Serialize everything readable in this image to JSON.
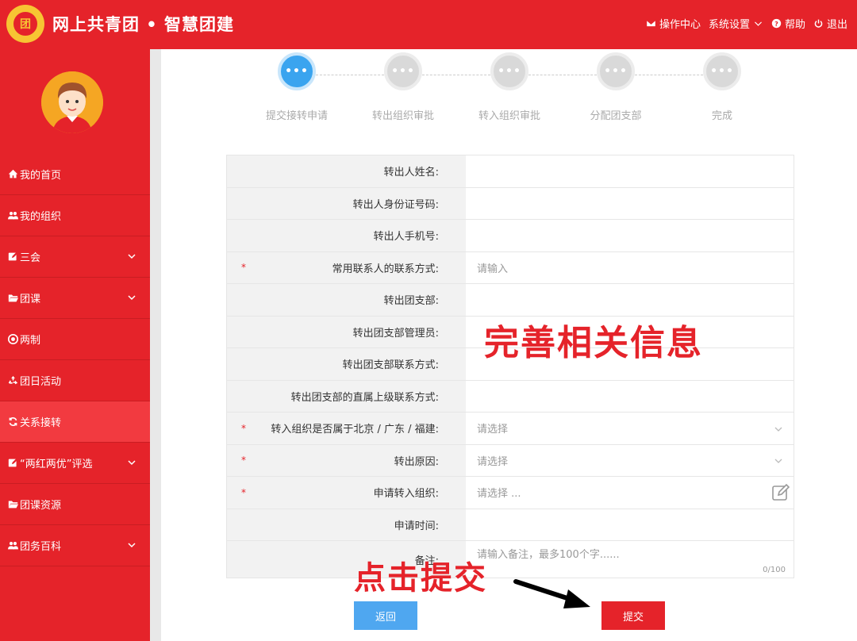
{
  "header": {
    "title": "网上共青团 • 智慧团建",
    "nav": [
      {
        "label": "操作中心",
        "icon": "envelope-icon"
      },
      {
        "label": "系统设置",
        "icon": "chevron-down-icon"
      },
      {
        "label": "帮助",
        "icon": "help-icon"
      },
      {
        "label": "退出",
        "icon": "power-icon"
      }
    ]
  },
  "sidebar": {
    "items": [
      {
        "label": "我的首页",
        "icon": "home-icon",
        "expandable": false
      },
      {
        "label": "我的组织",
        "icon": "users-icon",
        "expandable": false
      },
      {
        "label": "三会",
        "icon": "edit-icon",
        "expandable": true
      },
      {
        "label": "团课",
        "icon": "folder-open-icon",
        "expandable": true
      },
      {
        "label": "两制",
        "icon": "target-icon",
        "expandable": false
      },
      {
        "label": "团日活动",
        "icon": "recycle-icon",
        "expandable": false
      },
      {
        "label": "关系接转",
        "icon": "refresh-icon",
        "expandable": false,
        "active": true
      },
      {
        "label": "“两红两优”评选",
        "icon": "edit-icon",
        "expandable": true
      },
      {
        "label": "团课资源",
        "icon": "folder-open-icon",
        "expandable": false
      },
      {
        "label": "团务百科",
        "icon": "users-icon",
        "expandable": true
      }
    ]
  },
  "steps": {
    "items": [
      {
        "label": "提交接转申请",
        "glyph": "•••",
        "active": true
      },
      {
        "label": "转出组织审批",
        "glyph": "•••",
        "active": false
      },
      {
        "label": "转入组织审批",
        "glyph": "•••",
        "active": false
      },
      {
        "label": "分配团支部",
        "glyph": "•••",
        "active": false
      },
      {
        "label": "完成",
        "glyph": "•••",
        "active": false
      }
    ]
  },
  "form": {
    "rows": [
      {
        "label": "转出人姓名:",
        "required": false,
        "value": ""
      },
      {
        "label": "转出人身份证号码:",
        "required": false,
        "value": ""
      },
      {
        "label": "转出人手机号:",
        "required": false,
        "value": ""
      },
      {
        "label": "常用联系人的联系方式:",
        "required": true,
        "placeholder": "请输入"
      },
      {
        "label": "转出团支部:",
        "required": false,
        "value": ""
      },
      {
        "label": "转出团支部管理员:",
        "required": false,
        "value": ""
      },
      {
        "label": "转出团支部联系方式:",
        "required": false,
        "value": ""
      },
      {
        "label": "转出团支部的直属上级联系方式:",
        "required": false,
        "value": ""
      },
      {
        "label": "转入组织是否属于北京 / 广东 / 福建:",
        "required": true,
        "placeholder": "请选择",
        "type": "select"
      },
      {
        "label": "转出原因:",
        "required": true,
        "placeholder": "请选择",
        "type": "select"
      },
      {
        "label": "申请转入组织:",
        "required": true,
        "placeholder": "请选择 ...",
        "type": "picker"
      },
      {
        "label": "申请时间:",
        "required": false,
        "value": ""
      },
      {
        "label": "备注:",
        "required": false,
        "placeholder": "请输入备注，最多100个字......",
        "type": "textarea",
        "counter": "0/100"
      }
    ],
    "required_mark": "*"
  },
  "annotations": {
    "complete_info": "完善相关信息",
    "click_submit": "点击提交"
  },
  "buttons": {
    "back": "返回",
    "submit": "提交"
  },
  "colors": {
    "brand_red": "#e5232a",
    "active_step_blue": "#3aa4ef",
    "back_button_blue": "#4fa7f0"
  }
}
